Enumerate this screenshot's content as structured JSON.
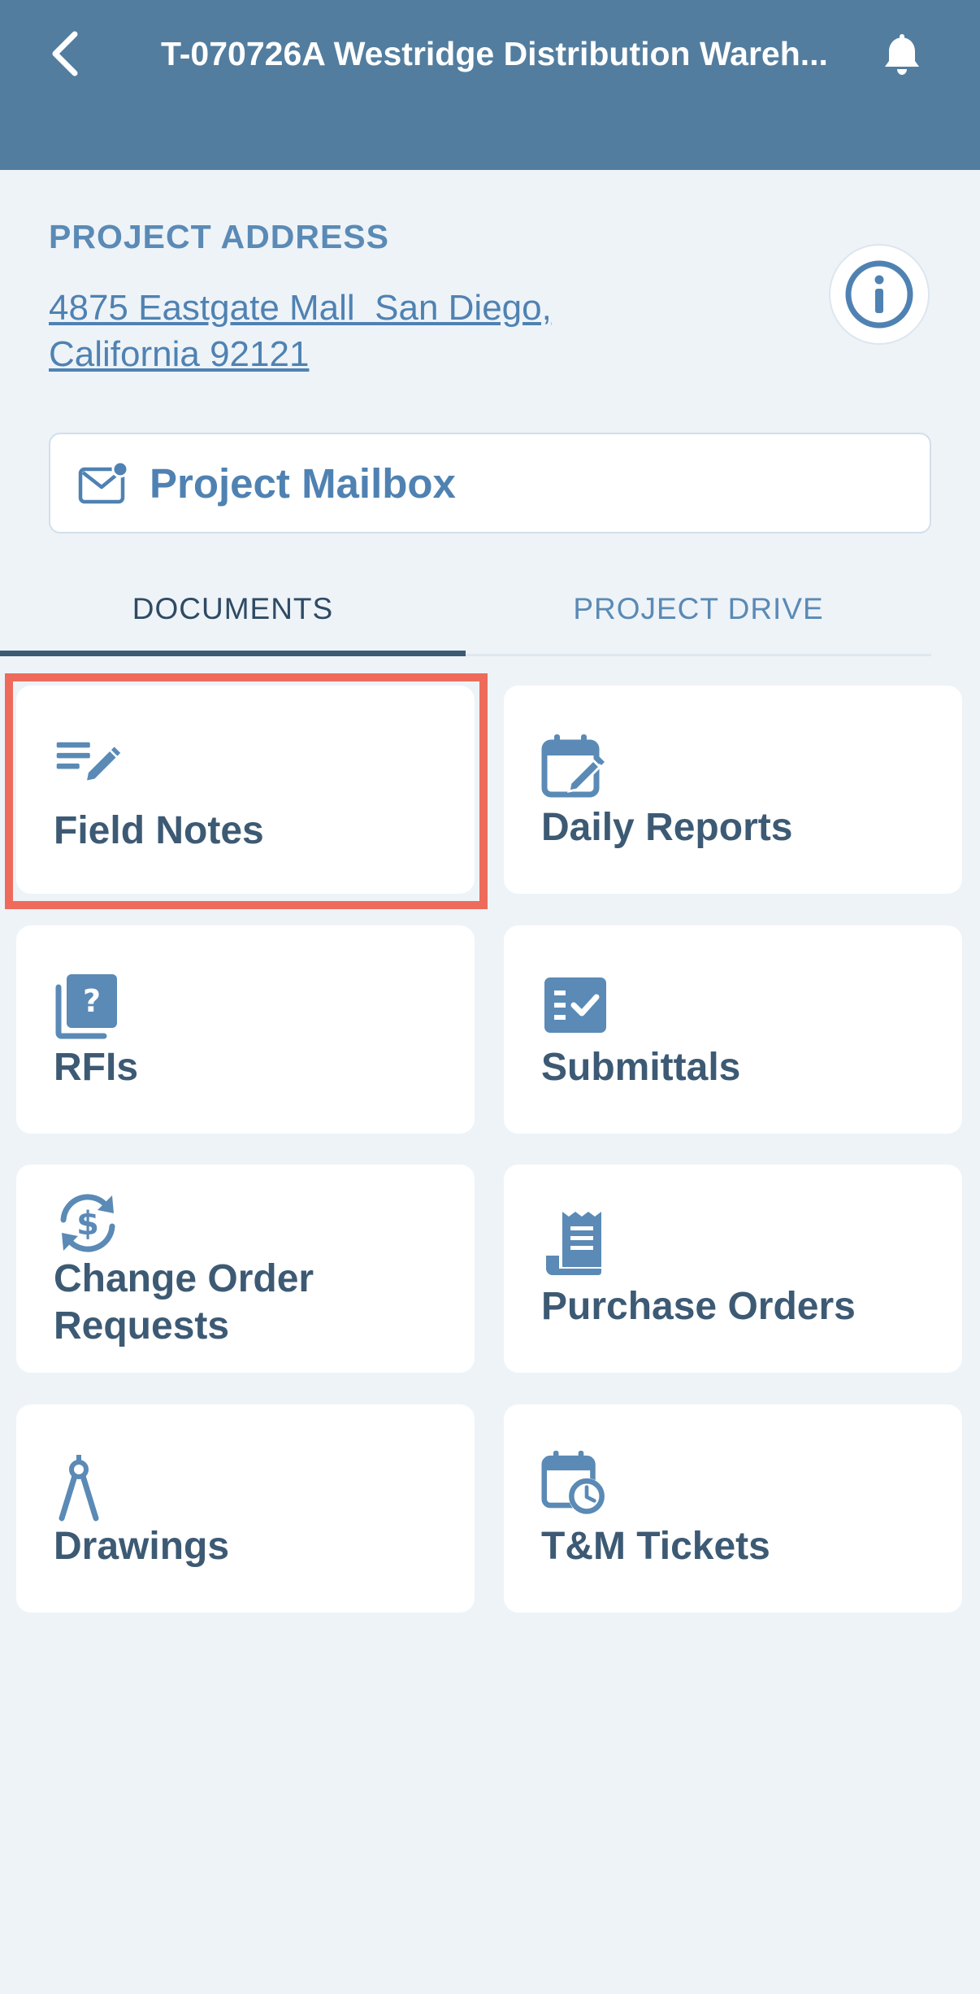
{
  "header": {
    "title": "T-070726A Westridge Distribution Wareh...",
    "back_icon": "chevron-left-icon",
    "bell_icon": "bell-icon",
    "background_color": "#527d9f"
  },
  "address": {
    "heading": "PROJECT ADDRESS",
    "line1": "4875 Eastgate Mall  San Diego,",
    "line2": "California 92121",
    "info_icon": "info-icon"
  },
  "mailbox": {
    "label": "Project Mailbox",
    "icon": "mail-icon"
  },
  "tabs": [
    {
      "label": "DOCUMENTS",
      "active": true
    },
    {
      "label": "PROJECT DRIVE",
      "active": false
    }
  ],
  "cards": [
    {
      "label": "Field Notes",
      "icon": "notes-edit-icon",
      "highlighted": true
    },
    {
      "label": "Daily Reports",
      "icon": "calendar-edit-icon"
    },
    {
      "label": "RFIs",
      "icon": "question-book-icon"
    },
    {
      "label": "Submittals",
      "icon": "checklist-icon"
    },
    {
      "label": "Change Order\nRequests",
      "icon": "dollar-refresh-icon"
    },
    {
      "label": "Purchase Orders",
      "icon": "receipt-icon"
    },
    {
      "label": "Drawings",
      "icon": "compass-icon"
    },
    {
      "label": "T&M Tickets",
      "icon": "calendar-clock-icon"
    }
  ],
  "colors": {
    "accent": "#4f82b2",
    "text_dark": "#3d5a74",
    "background": "#eef3f8",
    "highlight": "#ee6b5b"
  }
}
